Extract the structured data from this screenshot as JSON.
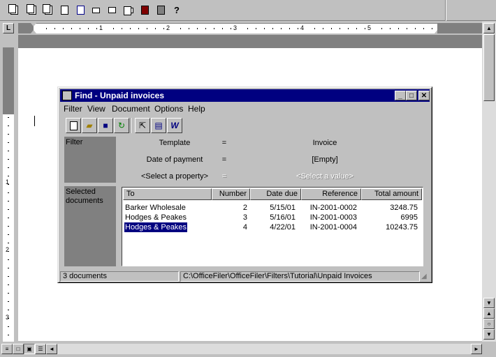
{
  "toolbar": {
    "buttons": [
      "new-document-icon",
      "new-folder-icon",
      "find-icon",
      "preview-icon",
      "edit-icon",
      "list-view-icon",
      "details-view-icon",
      "properties-icon",
      "calendar-icon",
      "scan-icon",
      "help-icon"
    ],
    "help_label": "?"
  },
  "ruler": {
    "tab_label": "L",
    "numbers": [
      "1",
      "2",
      "3",
      "4",
      "5"
    ]
  },
  "vruler": {
    "numbers": [
      "1",
      "2",
      "3"
    ]
  },
  "find": {
    "title": "Find - Unpaid invoices",
    "menu": [
      "Filter",
      "View",
      "Document",
      "Options",
      "Help"
    ],
    "filter_label": "Filter",
    "selected_label": "Selected documents",
    "conditions": [
      {
        "property": "Template",
        "operator": "=",
        "value": "Invoice"
      },
      {
        "property": "Date of payment",
        "operator": "=",
        "value": "[Empty]"
      },
      {
        "property": "<Select a property>",
        "operator": "=",
        "value": "<Select a value>"
      }
    ],
    "columns": [
      "To",
      "Number",
      "Date due",
      "Reference",
      "Total amount"
    ],
    "rows": [
      {
        "to": "Barker Wholesale",
        "number": "2",
        "date_due": "5/15/01",
        "reference": "IN-2001-0002",
        "total": "3248.75"
      },
      {
        "to": "Hodges & Peakes",
        "number": "3",
        "date_due": "5/16/01",
        "reference": "IN-2001-0003",
        "total": "6995"
      },
      {
        "to": "Hodges & Peakes",
        "number": "4",
        "date_due": "4/22/01",
        "reference": "IN-2001-0004",
        "total": "10243.75"
      }
    ],
    "status_count": "3 documents",
    "status_path": "C:\\OfficeFiler\\OfficeFiler\\Filters\\Tutorial\\Unpaid Invoices"
  },
  "colors": {
    "title_bar": "#000080",
    "selection": "#000080",
    "panel": "#808080",
    "face": "#c0c0c0"
  }
}
